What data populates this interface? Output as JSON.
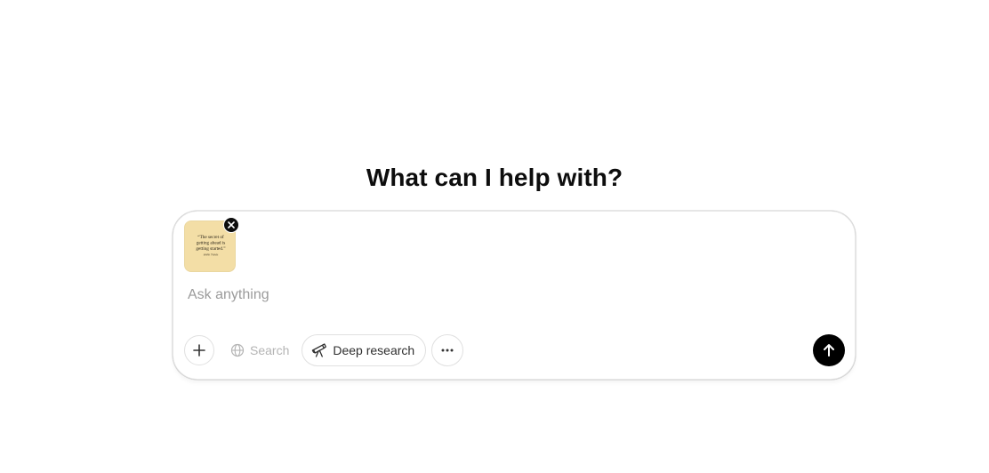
{
  "main": {
    "heading": "What can I help with?"
  },
  "composer": {
    "placeholder": "Ask anything",
    "attachment": {
      "quote": "“The secret of getting ahead is getting started.”",
      "author": "MARK TWAIN",
      "remove_icon": "close-icon"
    },
    "toolbar": {
      "add_icon": "plus-icon",
      "search_label": "Search",
      "search_icon": "globe-icon",
      "deep_research_label": "Deep research",
      "deep_research_icon": "telescope-icon",
      "more_icon": "more-horizontal-icon"
    },
    "send_icon": "arrow-up-icon"
  },
  "colors": {
    "send_button": "#000000",
    "text": "#0d0d0d",
    "placeholder": "#9b9b9b",
    "disabled_text": "#b4b4b4",
    "border": "#e0e0e0",
    "thumbnail_bg": "#f3dea6"
  }
}
